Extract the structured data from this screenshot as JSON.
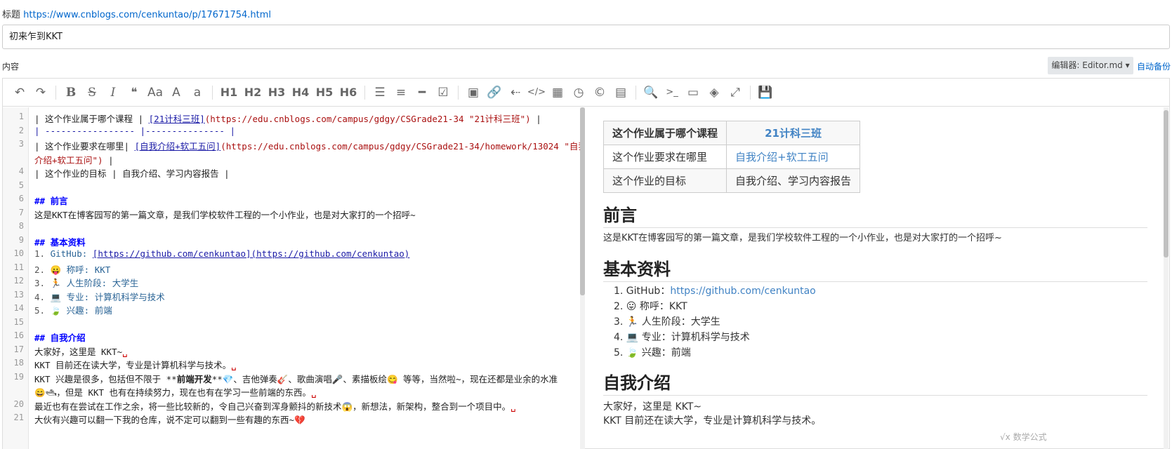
{
  "title_row": {
    "label": "标题",
    "url": "https://www.cnblogs.com/cenkuntao/p/17671754.html"
  },
  "title_input": {
    "value": "初来乍到KKT"
  },
  "content_label": "内容",
  "editor_select": "编辑器: Editor.md ▾",
  "autobackup": "自动备份",
  "toolbar": {
    "undo": "↶",
    "redo": "↷",
    "bold": "B",
    "strike": "S",
    "italic": "I",
    "quote": "❝",
    "upper": "Aa",
    "capitalize": "A",
    "lower": "a",
    "h1": "H1",
    "h2": "H2",
    "h3": "H3",
    "h4": "H4",
    "h5": "H5",
    "h6": "H6",
    "ul": "☰",
    "ol": "≡",
    "hr": "━",
    "task": "☑",
    "image": "▣",
    "link": "🔗",
    "anchor": "⇠",
    "code": "</>",
    "table": "▦",
    "datetime": "◷",
    "copyright": "©",
    "preformat": "▤",
    "search": "🔍",
    "terminal": ">_",
    "preview": "▭",
    "hide": "◈",
    "fullscreen": "⤢",
    "save": "💾"
  },
  "code_lines": [
    {
      "n": "1",
      "parts": [
        [
          "| 这个作业属于哪个课程 | ",
          ""
        ],
        [
          "[21计科三班]",
          "link"
        ],
        [
          "(https://edu.cnblogs.com/campus/gdgy/CSGrade21-34 \"21计科三班\")",
          "url"
        ],
        [
          " |",
          ""
        ]
      ]
    },
    {
      "n": "2",
      "parts": [
        [
          "| ----------------- |--------------- |",
          "blue"
        ]
      ]
    },
    {
      "n": "3",
      "parts": [
        [
          "| 这个作业要求在哪里| ",
          ""
        ],
        [
          "[自我介绍+软工五问]",
          "link"
        ],
        [
          "(https://edu.cnblogs.com/campus/gdgy/CSGrade21-34/homework/13024 \"自我",
          "url"
        ]
      ]
    },
    {
      "n": "",
      "parts": [
        [
          "介绍+软工五问\")",
          "url"
        ],
        [
          " |",
          ""
        ]
      ]
    },
    {
      "n": "4",
      "parts": [
        [
          "| 这个作业的目标 | 自我介绍、学习内容报告 |",
          ""
        ]
      ]
    },
    {
      "n": "5",
      "parts": []
    },
    {
      "n": "6",
      "parts": [
        [
          "## 前言",
          "hd"
        ]
      ]
    },
    {
      "n": "7",
      "parts": [
        [
          "这是KKT在博客园写的第一篇文章，是我们学校软件工程的一个小作业，也是对大家打的一个招呼~",
          ""
        ]
      ]
    },
    {
      "n": "8",
      "parts": []
    },
    {
      "n": "9",
      "parts": [
        [
          "## 基本资料",
          "hd"
        ]
      ]
    },
    {
      "n": "10",
      "parts": [
        [
          "1. ",
          "num"
        ],
        [
          "GitHub: ",
          "li"
        ],
        [
          "[https://github.com/cenkuntao](https://github.com/cenkuntao)",
          "link"
        ]
      ]
    },
    {
      "n": "11",
      "parts": [
        [
          "2. ",
          "num"
        ],
        [
          "😛 称呼: KKT",
          "li"
        ]
      ]
    },
    {
      "n": "12",
      "parts": [
        [
          "3. ",
          "num"
        ],
        [
          "🏃 人生阶段: 大学生",
          "li"
        ]
      ]
    },
    {
      "n": "13",
      "parts": [
        [
          "4. ",
          "num"
        ],
        [
          "💻 专业: 计算机科学与技术",
          "li"
        ]
      ]
    },
    {
      "n": "14",
      "parts": [
        [
          "5. ",
          "num"
        ],
        [
          "🍃 兴趣: 前端",
          "li"
        ]
      ]
    },
    {
      "n": "15",
      "parts": []
    },
    {
      "n": "16",
      "parts": [
        [
          "## 自我介绍",
          "hd"
        ]
      ]
    },
    {
      "n": "17",
      "parts": [
        [
          "大家好，这里是 KKT~",
          ""
        ],
        [
          "␣",
          "red"
        ]
      ]
    },
    {
      "n": "18",
      "parts": [
        [
          "KKT 目前还在读大学，专业是计算机科学与技术。",
          ""
        ],
        [
          "␣",
          "red"
        ]
      ]
    },
    {
      "n": "19",
      "parts": [
        [
          "KKT 兴趣是很多，包括但不限于 **",
          ""
        ],
        [
          "前端开发",
          "strong"
        ],
        [
          "**💎、吉他弹奏🎸、歌曲演唱🎤、素描板绘😋 等等，当然啦~，现在还都是业余的水准",
          ""
        ]
      ]
    },
    {
      "n": "",
      "parts": [
        [
          "😄🛥，但是 KKT 也有在持续努力，现在也有在学习一些前端的东西。",
          ""
        ],
        [
          "␣",
          "red"
        ]
      ]
    },
    {
      "n": "20",
      "parts": [
        [
          "最近也有在尝试在工作之余，将一些比较新的，令自己兴奋到浑身颤抖的新技术😱，新想法，新架构，整合到一个项目中。",
          ""
        ],
        [
          "␣",
          "red"
        ]
      ]
    },
    {
      "n": "21",
      "parts": [
        [
          "大伙有兴趣可以翻一下我的仓库，说不定可以翻到一些有趣的东西~💔",
          ""
        ]
      ]
    }
  ],
  "preview": {
    "table": [
      [
        "这个作业属于哪个课程",
        "21计科三班"
      ],
      [
        "这个作业要求在哪里",
        "自我介绍+软工五问"
      ],
      [
        "这个作业的目标",
        "自我介绍、学习内容报告"
      ]
    ],
    "h_intro": "前言",
    "p_intro": "这是KKT在博客园写的第一篇文章，是我们学校软件工程的一个小作业，也是对大家打的一个招呼~",
    "h_basic": "基本资料",
    "basic_items": [
      {
        "num": "1.",
        "label": "GitHub：",
        "link": "https://github.com/cenkuntao"
      },
      {
        "num": "2.",
        "label": "😛 称呼：KKT",
        "link": ""
      },
      {
        "num": "3.",
        "label": "🏃 人生阶段：大学生",
        "link": ""
      },
      {
        "num": "4.",
        "label": "💻 专业：计算机科学与技术",
        "link": ""
      },
      {
        "num": "5.",
        "label": "🍃 兴趣：前端",
        "link": ""
      }
    ],
    "h_self": "自我介绍",
    "p_self1": "大家好，这里是 KKT~",
    "p_self2": "KKT 目前还在读大学，专业是计算机科学与技术。"
  },
  "math_link": "√x 数学公式"
}
